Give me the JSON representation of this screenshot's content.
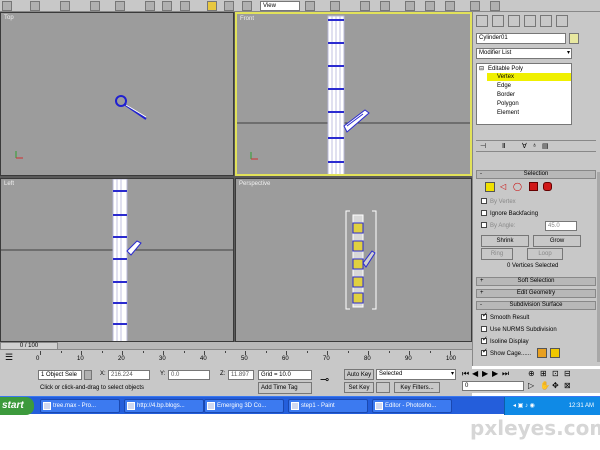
{
  "toolbar": {
    "dropdown_value": "View"
  },
  "viewports": {
    "top": {
      "label": "Top"
    },
    "front": {
      "label": "Front"
    },
    "left": {
      "label": "Left"
    },
    "perspective": {
      "label": "Perspective"
    }
  },
  "panel": {
    "object_name": "Cylinder01",
    "modifier_list": "Modifier List",
    "stack": {
      "root": "Editable Poly",
      "items": [
        "Vertex",
        "Edge",
        "Border",
        "Polygon",
        "Element"
      ],
      "selected": "Vertex"
    },
    "selection": {
      "title": "Selection",
      "by_vertex": "By Vertex",
      "ignore_backfacing": "Ignore Backfacing",
      "by_angle": "By Angle:",
      "angle_value": "45.0",
      "shrink": "Shrink",
      "grow": "Grow",
      "ring": "Ring",
      "loop": "Loop",
      "status": "0 Vertices Selected"
    },
    "rollouts": {
      "soft_selection": "Soft Selection",
      "edit_geometry": "Edit Geometry",
      "subdivision_surface": "Subdivision Surface"
    },
    "subdivision": {
      "smooth_result": "Smooth Result",
      "use_nurms": "Use NURMS Subdivision",
      "isoline_display": "Isoline Display",
      "show_cage": "Show Cage......"
    },
    "colors": {
      "cage1": "#e8a020",
      "cage2": "#f0c800"
    }
  },
  "timeline": {
    "slider": "0 / 100",
    "ticks": [
      "0",
      "10",
      "20",
      "30",
      "40",
      "50",
      "60",
      "70",
      "80",
      "90",
      "100"
    ]
  },
  "status": {
    "object_count": "1 Object Sele",
    "x_label": "X:",
    "x_value": "216.224",
    "y_label": "Y:",
    "y_value": "0.0",
    "z_label": "Z:",
    "z_value": "11.897",
    "grid": "Grid = 10.0",
    "prompt": "Click or click-and-drag to select objects",
    "add_time_tag": "Add Time Tag",
    "auto_key": "Auto Key",
    "set_key": "Set Key",
    "selected_mode": "Selected",
    "key_filters": "Key Filters...",
    "frame_value": "0"
  },
  "taskbar": {
    "start": "start",
    "tasks": [
      "tree.max - Pro...",
      "http://4.bp.blogs...",
      "Emerging 3D Co...",
      "step1 - Paint",
      "Editor - Photosho..."
    ],
    "clock": "12:31 AM"
  },
  "watermark": "pxleyes.com"
}
